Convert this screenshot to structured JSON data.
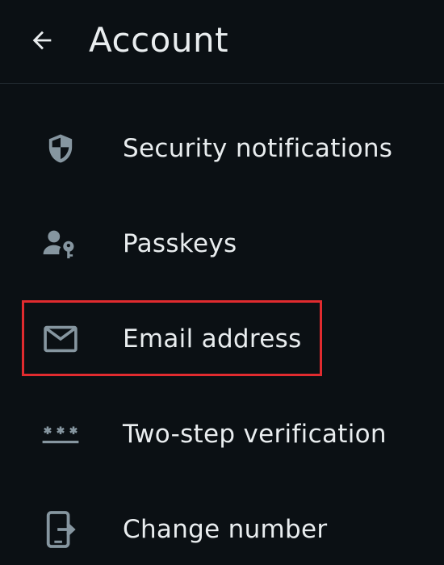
{
  "header": {
    "title": "Account",
    "back_icon": "arrow-left-icon"
  },
  "menu": {
    "items": [
      {
        "label": "Security notifications",
        "icon": "shield-icon"
      },
      {
        "label": "Passkeys",
        "icon": "person-key-icon"
      },
      {
        "label": "Email address",
        "icon": "envelope-icon"
      },
      {
        "label": "Two-step verification",
        "icon": "password-dots-icon"
      },
      {
        "label": "Change number",
        "icon": "phone-transfer-icon"
      }
    ],
    "highlighted_item": "Email address"
  },
  "colors": {
    "background": "#0b1014",
    "text": "#e9edef",
    "icon": "#8696a0",
    "highlight": "#e12b2f",
    "divider": "#1f272d"
  }
}
